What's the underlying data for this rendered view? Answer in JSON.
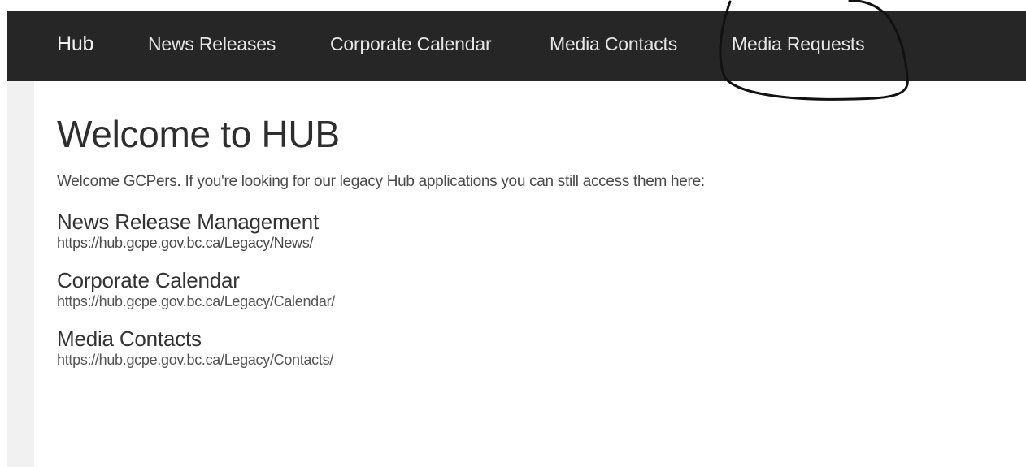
{
  "nav": {
    "brand": "Hub",
    "items": [
      {
        "label": "News Releases"
      },
      {
        "label": "Corporate Calendar"
      },
      {
        "label": "Media Contacts"
      },
      {
        "label": "Media Requests"
      }
    ]
  },
  "main": {
    "title": "Welcome to HUB",
    "intro": "Welcome GCPers. If you're looking for our legacy Hub applications you can still access them here:",
    "sections": [
      {
        "title": "News Release Management",
        "url": "https://hub.gcpe.gov.bc.ca/Legacy/News/"
      },
      {
        "title": "Corporate Calendar",
        "url": "https://hub.gcpe.gov.bc.ca/Legacy/Calendar/"
      },
      {
        "title": "Media Contacts",
        "url": "https://hub.gcpe.gov.bc.ca/Legacy/Contacts/"
      }
    ]
  },
  "colors": {
    "navbar_bg": "#262626",
    "nav_text": "#e6e6e6",
    "body_text": "#333333"
  }
}
